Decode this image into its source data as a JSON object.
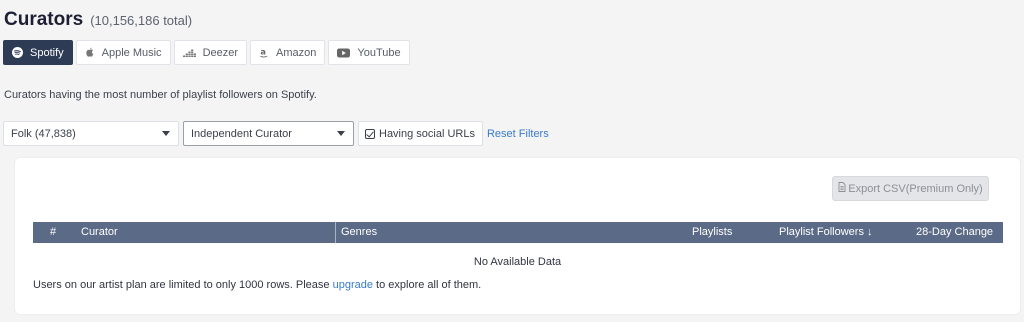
{
  "header": {
    "title": "Curators",
    "total": "(10,156,186 total)"
  },
  "tabs": [
    {
      "label": "Spotify",
      "icon": "spotify-icon",
      "active": true
    },
    {
      "label": "Apple Music",
      "icon": "apple-icon",
      "active": false
    },
    {
      "label": "Deezer",
      "icon": "deezer-icon",
      "active": false
    },
    {
      "label": "Amazon",
      "icon": "amazon-icon",
      "active": false
    },
    {
      "label": "YouTube",
      "icon": "youtube-icon",
      "active": false
    }
  ],
  "description": "Curators having the most number of playlist followers on Spotify.",
  "filters": {
    "genre": "Folk (47,838)",
    "curator_type": "Independent Curator",
    "social_urls_label": "Having social URLs",
    "social_urls_checked": true,
    "reset_label": "Reset Filters"
  },
  "table": {
    "export_label": "Export CSV(Premium Only)",
    "columns": {
      "index": "#",
      "curator": "Curator",
      "genres": "Genres",
      "playlists": "Playlists",
      "followers": "Playlist Followers ↓",
      "change": "28-Day Change"
    },
    "empty_text": "No Available Data",
    "note_before": "Users on our artist plan are limited to only 1000 rows. Please",
    "note_link": "upgrade",
    "note_after": "to explore all of them."
  },
  "colors": {
    "active_tab": "#2e3b55",
    "table_header": "#5b6a86",
    "link": "#3a7bc8"
  }
}
